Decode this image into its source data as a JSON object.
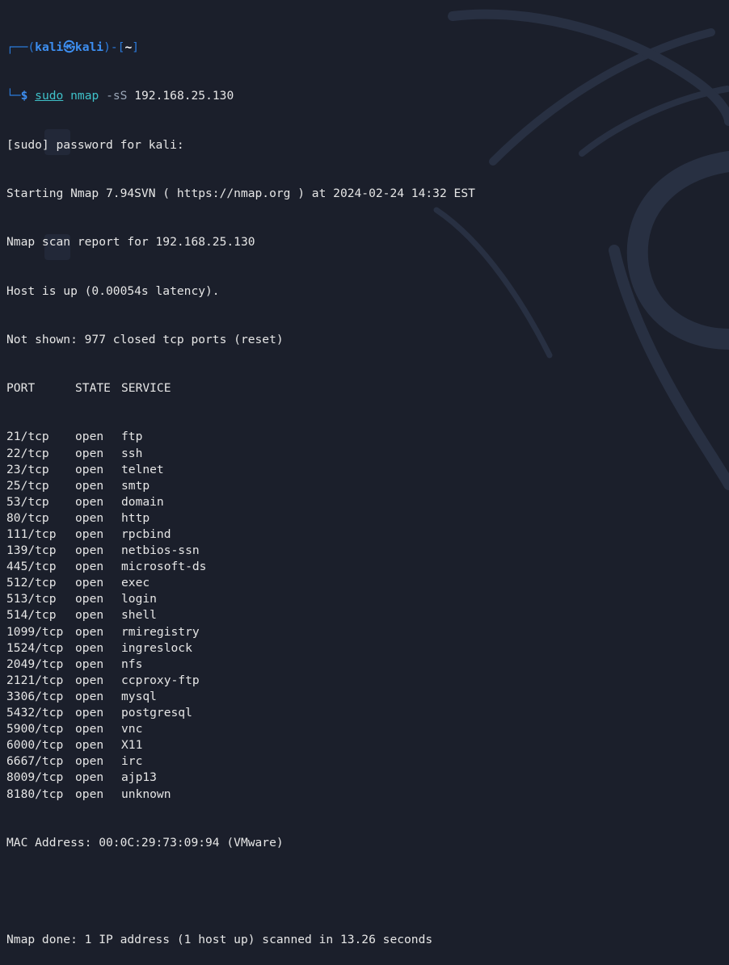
{
  "prompt": {
    "open": "┌──(",
    "user": "kali",
    "at": "㉿",
    "host": "kali",
    "mid": ")-[",
    "dir": "~",
    "close": "]",
    "line2_prefix": "└─",
    "dollar": "$"
  },
  "command": {
    "sudo": "sudo",
    "program": "nmap",
    "flag": "-sS",
    "target": "192.168.25.130"
  },
  "output_head": [
    "[sudo] password for kali:",
    "Starting Nmap 7.94SVN ( https://nmap.org ) at 2024-02-24 14:32 EST",
    "Nmap scan report for 192.168.25.130",
    "Host is up (0.00054s latency).",
    "Not shown: 977 closed tcp ports (reset)"
  ],
  "table_header": {
    "port": "PORT",
    "state": "STATE",
    "service": "SERVICE"
  },
  "ports": [
    {
      "port": "21/tcp",
      "state": "open",
      "service": "ftp"
    },
    {
      "port": "22/tcp",
      "state": "open",
      "service": "ssh"
    },
    {
      "port": "23/tcp",
      "state": "open",
      "service": "telnet"
    },
    {
      "port": "25/tcp",
      "state": "open",
      "service": "smtp"
    },
    {
      "port": "53/tcp",
      "state": "open",
      "service": "domain"
    },
    {
      "port": "80/tcp",
      "state": "open",
      "service": "http"
    },
    {
      "port": "111/tcp",
      "state": "open",
      "service": "rpcbind"
    },
    {
      "port": "139/tcp",
      "state": "open",
      "service": "netbios-ssn"
    },
    {
      "port": "445/tcp",
      "state": "open",
      "service": "microsoft-ds"
    },
    {
      "port": "512/tcp",
      "state": "open",
      "service": "exec"
    },
    {
      "port": "513/tcp",
      "state": "open",
      "service": "login"
    },
    {
      "port": "514/tcp",
      "state": "open",
      "service": "shell"
    },
    {
      "port": "1099/tcp",
      "state": "open",
      "service": "rmiregistry"
    },
    {
      "port": "1524/tcp",
      "state": "open",
      "service": "ingreslock"
    },
    {
      "port": "2049/tcp",
      "state": "open",
      "service": "nfs"
    },
    {
      "port": "2121/tcp",
      "state": "open",
      "service": "ccproxy-ftp"
    },
    {
      "port": "3306/tcp",
      "state": "open",
      "service": "mysql"
    },
    {
      "port": "5432/tcp",
      "state": "open",
      "service": "postgresql"
    },
    {
      "port": "5900/tcp",
      "state": "open",
      "service": "vnc"
    },
    {
      "port": "6000/tcp",
      "state": "open",
      "service": "X11"
    },
    {
      "port": "6667/tcp",
      "state": "open",
      "service": "irc"
    },
    {
      "port": "8009/tcp",
      "state": "open",
      "service": "ajp13"
    },
    {
      "port": "8180/tcp",
      "state": "open",
      "service": "unknown"
    }
  ],
  "mac_line": "MAC Address: 00:0C:29:73:09:94 (VMware)",
  "done_line": "Nmap done: 1 IP address (1 host up) scanned in 13.26 seconds",
  "colors": {
    "background": "#1b1f2b",
    "prompt_blue": "#3d8ef0",
    "command_cyan": "#3fc1c9",
    "text": "#e6e6e6"
  }
}
